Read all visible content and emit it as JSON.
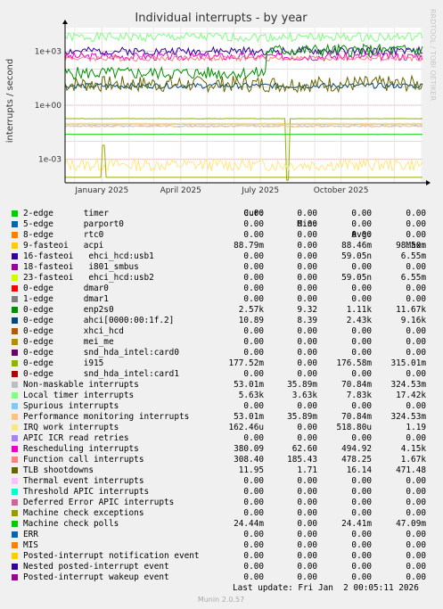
{
  "chart_data": {
    "type": "line",
    "title": "Individual interrupts - by year",
    "ylabel": "interrupts / second",
    "y_scale": "log",
    "ylim": [
      5e-05,
      20000
    ],
    "y_ticks": [
      {
        "value": 1000,
        "label": "1e+03"
      },
      {
        "value": 1,
        "label": "1e+00"
      },
      {
        "value": 0.001,
        "label": "1e-03"
      }
    ],
    "x_range": [
      "2024-11-20",
      "2026-01-02"
    ],
    "x_ticks": [
      {
        "date": "2025-01-01",
        "label": "January 2025"
      },
      {
        "date": "2025-04-01",
        "label": "April 2025"
      },
      {
        "date": "2025-07-01",
        "label": "July 2025"
      },
      {
        "date": "2025-10-01",
        "label": "October 2025"
      }
    ],
    "grid": true,
    "side_label": "RRDTOOL / TOBI OETIKER",
    "columns": [
      "Cur:",
      "Min:",
      "Avg:",
      "Max:"
    ],
    "series": [
      {
        "name": "2-edge      timer",
        "color": "#00cc00",
        "cur": "0.00",
        "min": "0.00",
        "avg": "0.00",
        "max": "0.00"
      },
      {
        "name": "5-edge      parport0",
        "color": "#0066b3",
        "cur": "0.00",
        "min": "0.00",
        "avg": "0.00",
        "max": "0.00"
      },
      {
        "name": "8-edge      rtc0",
        "color": "#ff8000",
        "cur": "0.00",
        "min": "0.00",
        "avg": "0.00",
        "max": "0.00"
      },
      {
        "name": "9-fasteoi   acpi",
        "color": "#ffcc00",
        "cur": "88.79m",
        "min": "0.00",
        "avg": "88.46m",
        "max": "98.50m"
      },
      {
        "name": "16-fasteoi   ehci_hcd:usb1",
        "color": "#330099",
        "cur": "0.00",
        "min": "0.00",
        "avg": "59.05n",
        "max": "6.55m"
      },
      {
        "name": "18-fasteoi   i801_smbus",
        "color": "#990099",
        "cur": "0.00",
        "min": "0.00",
        "avg": "0.00",
        "max": "0.00"
      },
      {
        "name": "23-fasteoi   ehci_hcd:usb2",
        "color": "#ccff00",
        "cur": "0.00",
        "min": "0.00",
        "avg": "59.05n",
        "max": "6.55m"
      },
      {
        "name": "0-edge      dmar0",
        "color": "#ff0000",
        "cur": "0.00",
        "min": "0.00",
        "avg": "0.00",
        "max": "0.00"
      },
      {
        "name": "1-edge      dmar1",
        "color": "#808080",
        "cur": "0.00",
        "min": "0.00",
        "avg": "0.00",
        "max": "0.00"
      },
      {
        "name": "0-edge      enp2s0",
        "color": "#008f00",
        "cur": "2.57k",
        "min": "9.32",
        "avg": "1.11k",
        "max": "11.67k"
      },
      {
        "name": "0-edge      ahci[0000:00:1f.2]",
        "color": "#00487d",
        "cur": "10.89",
        "min": "8.39",
        "avg": "2.43k",
        "max": "9.16k"
      },
      {
        "name": "0-edge      xhci_hcd",
        "color": "#b35a00",
        "cur": "0.00",
        "min": "0.00",
        "avg": "0.00",
        "max": "0.00"
      },
      {
        "name": "0-edge      mei_me",
        "color": "#b38f00",
        "cur": "0.00",
        "min": "0.00",
        "avg": "0.00",
        "max": "0.00"
      },
      {
        "name": "0-edge      snd_hda_intel:card0",
        "color": "#6b006b",
        "cur": "0.00",
        "min": "0.00",
        "avg": "0.00",
        "max": "0.00"
      },
      {
        "name": "0-edge      i915",
        "color": "#8fb300",
        "cur": "177.52m",
        "min": "0.00",
        "avg": "176.58m",
        "max": "315.01m"
      },
      {
        "name": "0-edge      snd_hda_intel:card1",
        "color": "#b30000",
        "cur": "0.00",
        "min": "0.00",
        "avg": "0.00",
        "max": "0.00"
      },
      {
        "name": "Non-maskable interrupts",
        "color": "#bebebe",
        "cur": "53.01m",
        "min": "35.89m",
        "avg": "70.84m",
        "max": "324.53m"
      },
      {
        "name": "Local timer interrupts",
        "color": "#80ff80",
        "cur": "5.63k",
        "min": "3.63k",
        "avg": "7.83k",
        "max": "17.42k"
      },
      {
        "name": "Spurious interrupts",
        "color": "#80c9ff",
        "cur": "0.00",
        "min": "0.00",
        "avg": "0.00",
        "max": "0.00"
      },
      {
        "name": "Performance monitoring interrupts",
        "color": "#ffc080",
        "cur": "53.01m",
        "min": "35.89m",
        "avg": "70.84m",
        "max": "324.53m"
      },
      {
        "name": "IRQ work interrupts",
        "color": "#ffe680",
        "cur": "162.46u",
        "min": "0.00",
        "avg": "518.80u",
        "max": "1.19"
      },
      {
        "name": "APIC ICR read retries",
        "color": "#aa80ff",
        "cur": "0.00",
        "min": "0.00",
        "avg": "0.00",
        "max": "0.00"
      },
      {
        "name": "Rescheduling interrupts",
        "color": "#ee00cc",
        "cur": "380.09",
        "min": "62.60",
        "avg": "494.92",
        "max": "4.15k"
      },
      {
        "name": "Function call interrupts",
        "color": "#ff8080",
        "cur": "308.40",
        "min": "185.43",
        "avg": "478.25",
        "max": "1.67k"
      },
      {
        "name": "TLB shootdowns",
        "color": "#666600",
        "cur": "11.95",
        "min": "1.71",
        "avg": "16.14",
        "max": "471.48"
      },
      {
        "name": "Thermal event interrupts",
        "color": "#ffbfff",
        "cur": "0.00",
        "min": "0.00",
        "avg": "0.00",
        "max": "0.00"
      },
      {
        "name": "Threshold APIC interrupts",
        "color": "#00ffcc",
        "cur": "0.00",
        "min": "0.00",
        "avg": "0.00",
        "max": "0.00"
      },
      {
        "name": "Deferred Error APIC interrupts",
        "color": "#cc6699",
        "cur": "0.00",
        "min": "0.00",
        "avg": "0.00",
        "max": "0.00"
      },
      {
        "name": "Machine check exceptions",
        "color": "#999900",
        "cur": "0.00",
        "min": "0.00",
        "avg": "0.00",
        "max": "0.00"
      },
      {
        "name": "Machine check polls",
        "color": "#00cc00",
        "cur": "24.44m",
        "min": "0.00",
        "avg": "24.41m",
        "max": "47.09m"
      },
      {
        "name": "ERR",
        "color": "#0066b3",
        "cur": "0.00",
        "min": "0.00",
        "avg": "0.00",
        "max": "0.00"
      },
      {
        "name": "MIS",
        "color": "#ff8000",
        "cur": "0.00",
        "min": "0.00",
        "avg": "0.00",
        "max": "0.00"
      },
      {
        "name": "Posted-interrupt notification event",
        "color": "#ffcc00",
        "cur": "0.00",
        "min": "0.00",
        "avg": "0.00",
        "max": "0.00"
      },
      {
        "name": "Nested posted-interrupt event",
        "color": "#330099",
        "cur": "0.00",
        "min": "0.00",
        "avg": "0.00",
        "max": "0.00"
      },
      {
        "name": "Posted-interrupt wakeup event",
        "color": "#990099",
        "cur": "0.00",
        "min": "0.00",
        "avg": "0.00",
        "max": "0.00"
      }
    ],
    "plotted": [
      {
        "color": "#80ff80",
        "level": 6000,
        "jitter": 0.25,
        "seed": 1
      },
      {
        "color": "#330099",
        "level": 1000,
        "jitter": 0.22,
        "seed": 2
      },
      {
        "color": "#ee00cc",
        "level": 500,
        "jitter": 0.22,
        "seed": 3
      },
      {
        "color": "#ff8080",
        "level": 400,
        "jitter": 0.15,
        "seed": 4
      },
      {
        "color": "#008f00",
        "level": 60,
        "jitter": 0.35,
        "seed": 5,
        "late_level": 1100
      },
      {
        "color": "#00487d",
        "level": 12,
        "jitter": 0.15,
        "seed": 6
      },
      {
        "color": "#666600",
        "level": 15,
        "jitter": 0.45,
        "seed": 7
      },
      {
        "color": "#8fb300",
        "level": 0.18,
        "jitter": 0.01,
        "seed": 8,
        "dip": {
          "date": "2025-08-01",
          "value": 7e-05
        }
      },
      {
        "color": "#bebebe",
        "level": 0.07,
        "jitter": 0.05,
        "seed": 9
      },
      {
        "color": "#ffc080",
        "level": 0.07,
        "jitter": 0.05,
        "seed": 10
      },
      {
        "color": "#ffcc00",
        "level": 0.089,
        "jitter": 0.01,
        "seed": 11
      },
      {
        "color": "#00cc00",
        "level": 0.024,
        "jitter": 0.005,
        "seed": 12
      },
      {
        "color": "#ffe680",
        "level": 0.0005,
        "jitter": 0.35,
        "seed": 13
      },
      {
        "color": "#aaaa00",
        "level": 0.0001,
        "jitter": 0.0,
        "seed": 14,
        "spike": {
          "date": "2025-01-03",
          "value": 0.006
        }
      }
    ]
  },
  "last_update": "Last update: Fri Jan  2 00:05:11 2026",
  "footer": "Munin 2.0.57"
}
